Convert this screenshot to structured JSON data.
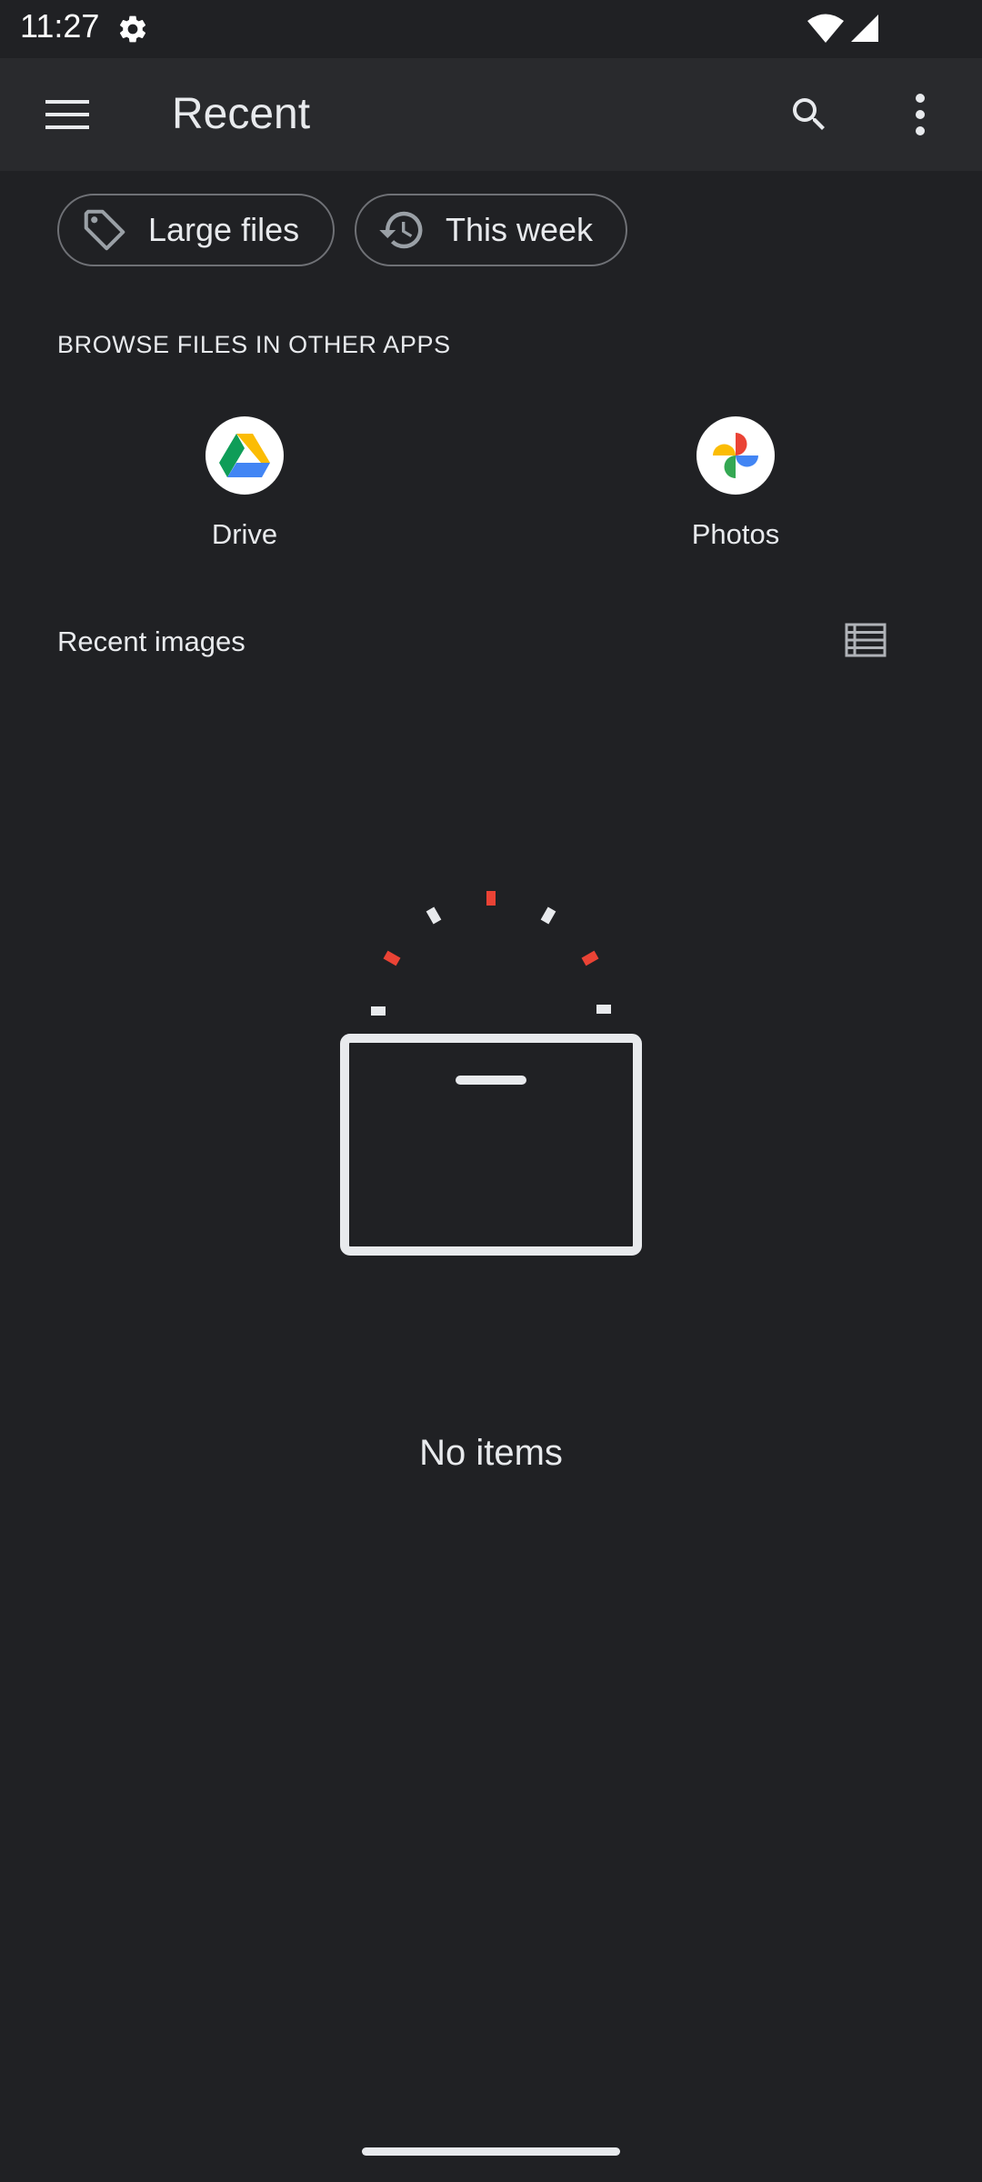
{
  "status_bar": {
    "time": "11:27",
    "icons": [
      "gear-icon",
      "wifi-icon",
      "cell-signal-icon"
    ]
  },
  "app_bar": {
    "title": "Recent",
    "icons": [
      "menu-icon",
      "search-icon",
      "more-vert-icon"
    ]
  },
  "filters": {
    "chips": [
      {
        "label": "Large files",
        "icon": "tag-icon"
      },
      {
        "label": "This week",
        "icon": "history-icon"
      }
    ]
  },
  "browse": {
    "heading": "BROWSE FILES IN OTHER APPS",
    "apps": [
      {
        "label": "Drive",
        "icon": "google-drive-icon"
      },
      {
        "label": "Photos",
        "icon": "google-photos-icon"
      }
    ]
  },
  "recent": {
    "heading": "Recent images",
    "view_icon": "list-view-icon"
  },
  "empty_state": {
    "message": "No items",
    "illustration": "empty-box-illustration"
  },
  "colors": {
    "background": "#202124",
    "app_bar": "#292a2d",
    "text": "#e8eaed",
    "accent_red": "#ea4335"
  }
}
